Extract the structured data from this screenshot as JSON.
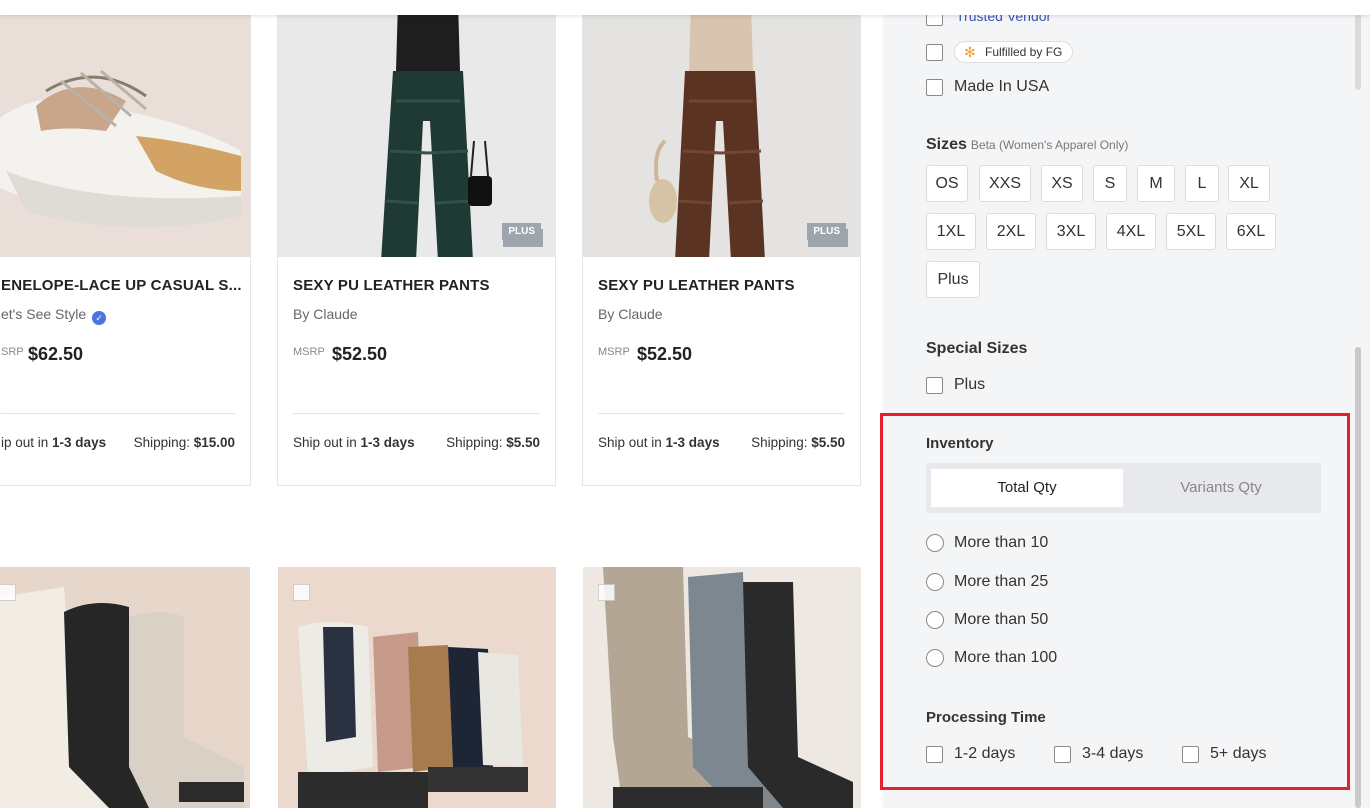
{
  "products": [
    {
      "title": "ENELOPE-LACE UP CASUAL S...",
      "vendor": "et's See Style",
      "msrp_label": "SRP",
      "price": "$62.50",
      "ship_prefix": "ip out in ",
      "ship_days": "1-3 days",
      "shipping_label": "Shipping: ",
      "shipping_cost": "$15.00",
      "verified": true,
      "badge": ""
    },
    {
      "title": "SEXY PU LEATHER PANTS",
      "vendor": "By Claude",
      "msrp_label": "MSRP",
      "price": "$52.50",
      "ship_prefix": "Ship out in ",
      "ship_days": "1-3 days",
      "shipping_label": "Shipping: ",
      "shipping_cost": "$5.50",
      "badge": "PLUS"
    },
    {
      "title": "SEXY PU LEATHER PANTS",
      "vendor": "By Claude",
      "msrp_label": "MSRP",
      "price": "$52.50",
      "ship_prefix": "Ship out in ",
      "ship_days": "1-3 days",
      "shipping_label": "Shipping: ",
      "shipping_cost": "$5.50",
      "badge": "PLUS"
    }
  ],
  "sidebar": {
    "trusted_vendor_partial": "Trusted Vendor",
    "fulfilled_by": "Fulfilled by FG",
    "made_in_usa": "Made In USA",
    "sizes_title": "Sizes",
    "sizes_beta": "Beta (Women's Apparel Only)",
    "sizes": [
      "OS",
      "XXS",
      "XS",
      "S",
      "M",
      "L",
      "XL",
      "1XL",
      "2XL",
      "3XL",
      "4XL",
      "5XL",
      "6XL",
      "Plus"
    ],
    "special_sizes_title": "Special Sizes",
    "special_sizes_option": "Plus",
    "inventory_title": "Inventory",
    "inventory_tabs": {
      "active": "Total Qty",
      "inactive": "Variants Qty"
    },
    "inventory_options": [
      "More than 10",
      "More than 25",
      "More than 50",
      "More than 100"
    ],
    "processing_title": "Processing Time",
    "processing_options": [
      "1-2 days",
      "3-4 days",
      "5+ days"
    ]
  },
  "colors": {
    "highlight": "#e3212b",
    "accent_blue": "#4a74e0",
    "sidebar_bg": "#f4f5f7"
  }
}
